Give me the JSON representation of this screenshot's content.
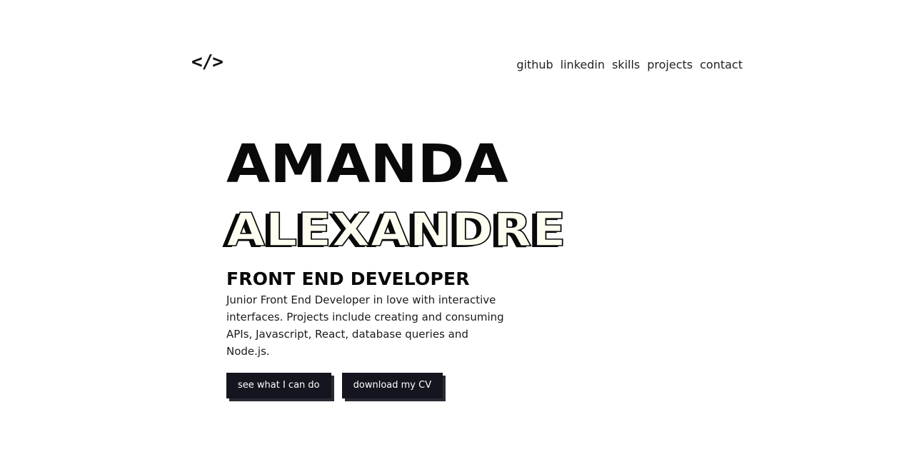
{
  "header": {
    "logo": "</>",
    "nav": [
      "github",
      "linkedin",
      "skills",
      "projects",
      "contact"
    ]
  },
  "hero": {
    "first_name": "AMANDA",
    "last_name": "ALEXANDRE",
    "role": "FRONT END DEVELOPER",
    "bio": "Junior Front End Developer in love with interactive interfaces. Projects include creating and consuming APIs, Javascript, React, database queries and Node.js.",
    "buttons": {
      "primary": "see what I can do",
      "secondary": "download my CV"
    }
  },
  "colors": {
    "text": "#0a0a0a",
    "button_bg": "#151520",
    "outline_fill": "#fdfdf0"
  }
}
